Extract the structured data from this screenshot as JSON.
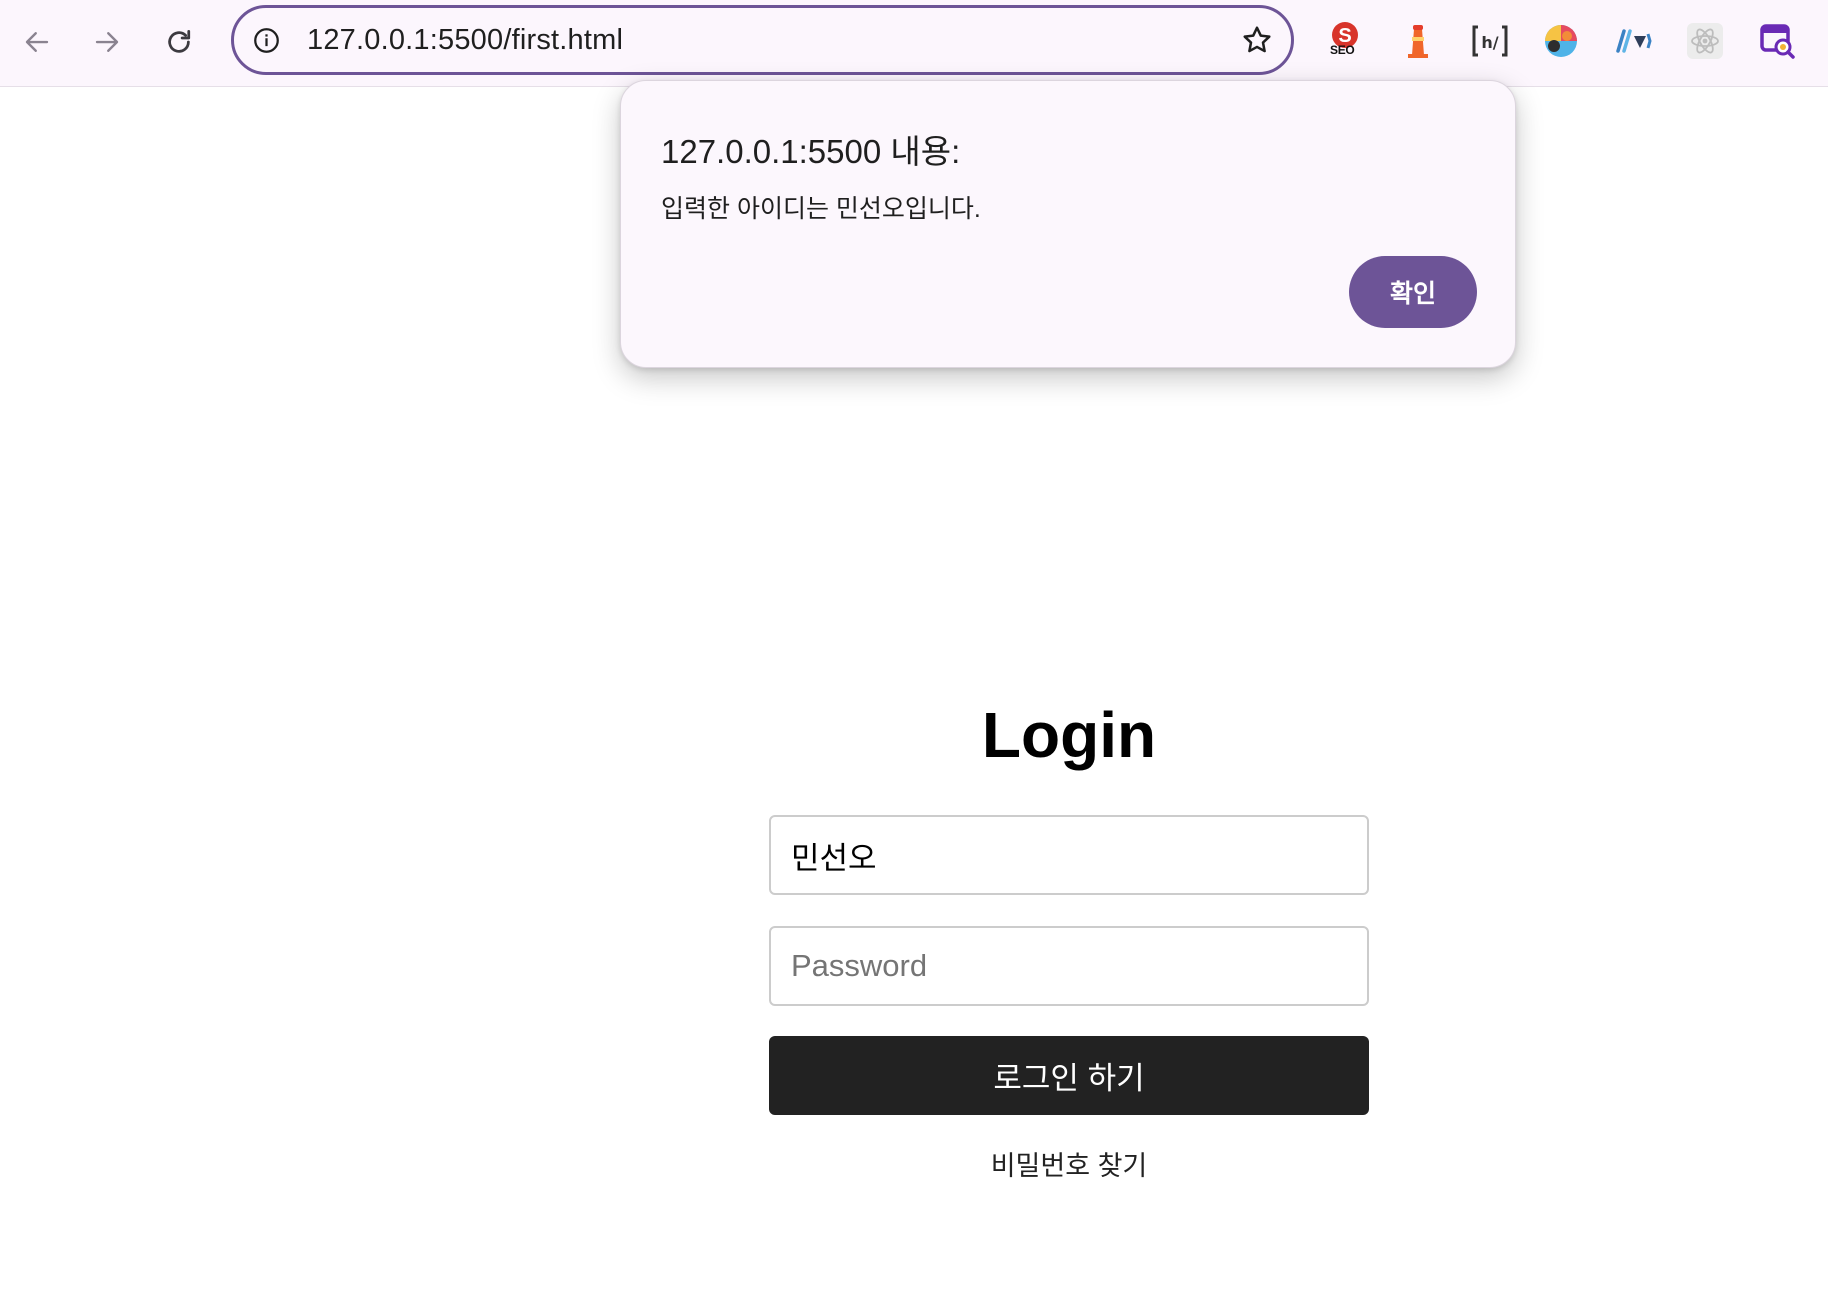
{
  "browser": {
    "url": "127.0.0.1:5500/first.html",
    "extensions": [
      {
        "name": "seo-extension-icon",
        "label": "SEO",
        "color": "#d8342b"
      },
      {
        "name": "lighthouse-extension-icon",
        "color": "#f0662a"
      },
      {
        "name": "headings-map-extension-icon",
        "color": "#333333"
      },
      {
        "name": "colorful-ball-extension-icon",
        "color": "#e64a5f"
      },
      {
        "name": "vue-devtools-extension-icon",
        "color": "#3b82c4"
      },
      {
        "name": "react-devtools-extension-icon",
        "color": "#bdbdbd"
      },
      {
        "name": "purple-search-extension-icon",
        "color": "#6a2ab5"
      }
    ]
  },
  "alert": {
    "title": "127.0.0.1:5500 내용:",
    "message": "입력한 아이디는 민선오입니다.",
    "ok_label": "확인",
    "accent": "#6d5497"
  },
  "login": {
    "heading": "Login",
    "id_value": "민선오",
    "password_placeholder": "Password",
    "submit_label": "로그인 하기",
    "find_password_label": "비밀번호 찾기"
  }
}
